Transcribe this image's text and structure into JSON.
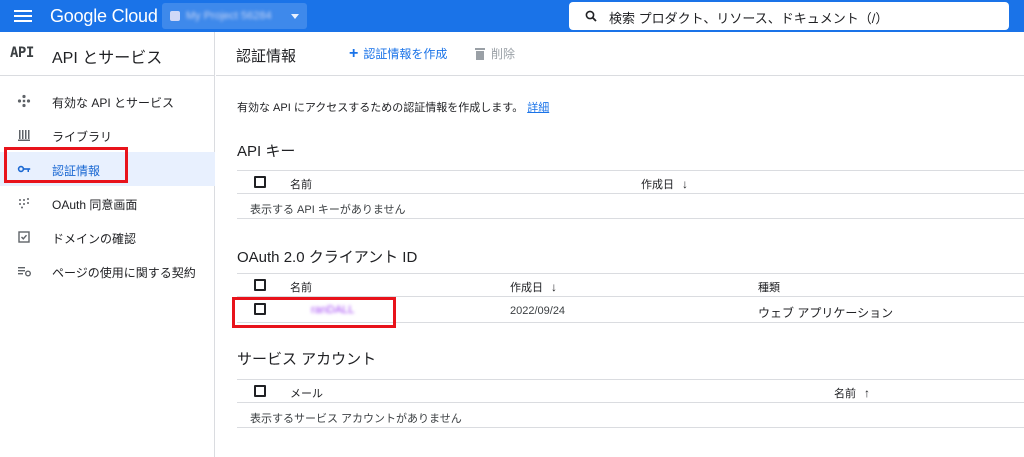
{
  "topbar": {
    "brand": "Google Cloud",
    "project_name": "My Project 56284",
    "search_placeholder": "検索  プロダクト、リソース、ドキュメント（/）"
  },
  "sidebar": {
    "badge": "API",
    "title": "API とサービス",
    "items": [
      {
        "label": "有効な API とサービス",
        "icon": "api-hub-icon"
      },
      {
        "label": "ライブラリ",
        "icon": "library-icon"
      },
      {
        "label": "認証情報",
        "icon": "key-icon",
        "active": true
      },
      {
        "label": "OAuth 同意画面",
        "icon": "consent-icon"
      },
      {
        "label": "ドメインの確認",
        "icon": "domain-check-icon"
      },
      {
        "label": "ページの使用に関する契約",
        "icon": "agreement-icon"
      }
    ]
  },
  "header": {
    "title": "認証情報",
    "create_label": "認証情報を作成",
    "delete_label": "削除"
  },
  "description": {
    "text": "有効な API にアクセスするための認証情報を作成します。",
    "link": "詳細"
  },
  "api_keys": {
    "title": "API キー",
    "columns": [
      "名前",
      "作成日"
    ],
    "empty": "表示する API キーがありません"
  },
  "oauth": {
    "title": "OAuth 2.0 クライアント ID",
    "columns": [
      "名前",
      "作成日",
      "種類"
    ],
    "rows": [
      {
        "name": "ranDALL",
        "created": "2022/09/24",
        "type": "ウェブ アプリケーション"
      }
    ]
  },
  "service_accounts": {
    "title": "サービス アカウント",
    "columns": [
      "メール",
      "名前"
    ],
    "empty": "表示するサービス アカウントがありません"
  },
  "colors": {
    "brand_blue": "#1a73e8",
    "highlight_red": "#e8131b",
    "active_bg": "#e8f0fe"
  }
}
